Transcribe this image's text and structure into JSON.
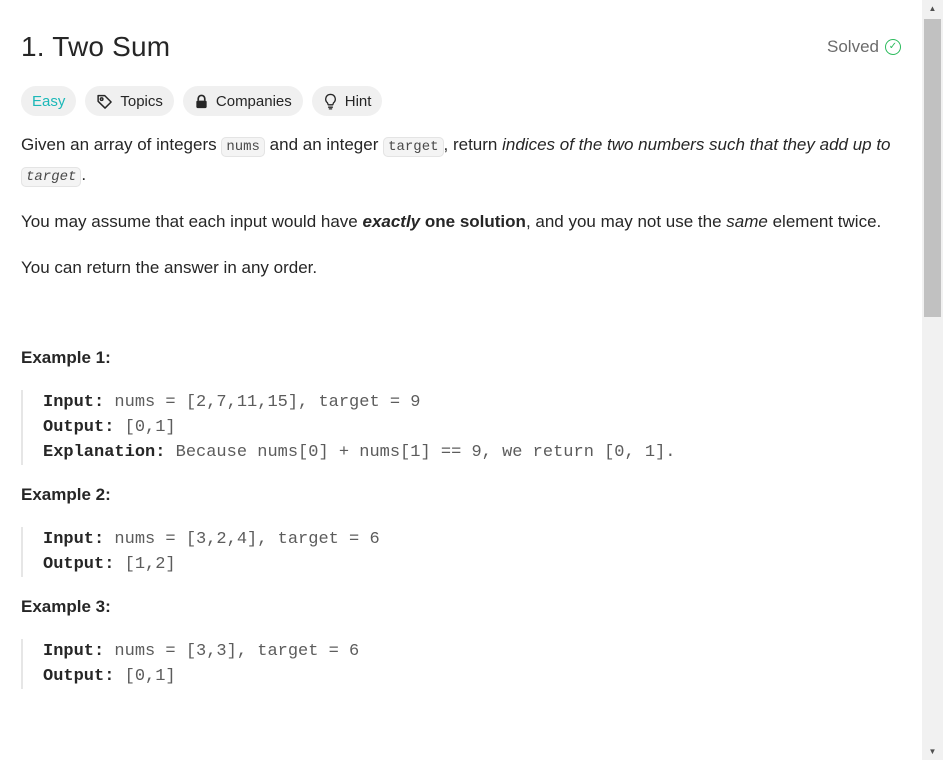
{
  "problem": {
    "title": "1. Two Sum",
    "status": "Solved"
  },
  "tags": {
    "difficulty": "Easy",
    "topics": "Topics",
    "companies": "Companies",
    "hint": "Hint"
  },
  "description": {
    "p1_a": "Given an array of integers ",
    "p1_code1": "nums",
    "p1_b": " and an integer ",
    "p1_code2": "target",
    "p1_c": ", return ",
    "p1_em": "indices of the two numbers such that they add up to",
    "p1_code3": "target",
    "p1_d": ".",
    "p2_a": "You may assume that each input would have ",
    "p2_bi": "exactly",
    "p2_b": " one solution",
    "p2_c": ", and you may not use the ",
    "p2_em": "same",
    "p2_d": " element twice.",
    "p3": "You can return the answer in any order."
  },
  "examples": [
    {
      "title": "Example 1:",
      "input_label": "Input:",
      "input": " nums = [2,7,11,15], target = 9",
      "output_label": "Output:",
      "output": " [0,1]",
      "explanation_label": "Explanation:",
      "explanation": " Because nums[0] + nums[1] == 9, we return [0, 1]."
    },
    {
      "title": "Example 2:",
      "input_label": "Input:",
      "input": " nums = [3,2,4], target = 6",
      "output_label": "Output:",
      "output": " [1,2]"
    },
    {
      "title": "Example 3:",
      "input_label": "Input:",
      "input": " nums = [3,3], target = 6",
      "output_label": "Output:",
      "output": " [0,1]"
    }
  ],
  "colors": {
    "easy": "#1cb8b8",
    "solved": "#2cbb5d",
    "tag_bg": "#f0f0f0"
  },
  "icons": {
    "status": "check-circle-icon",
    "topics": "tag-icon",
    "companies": "lock-icon",
    "hint": "lightbulb-icon"
  }
}
